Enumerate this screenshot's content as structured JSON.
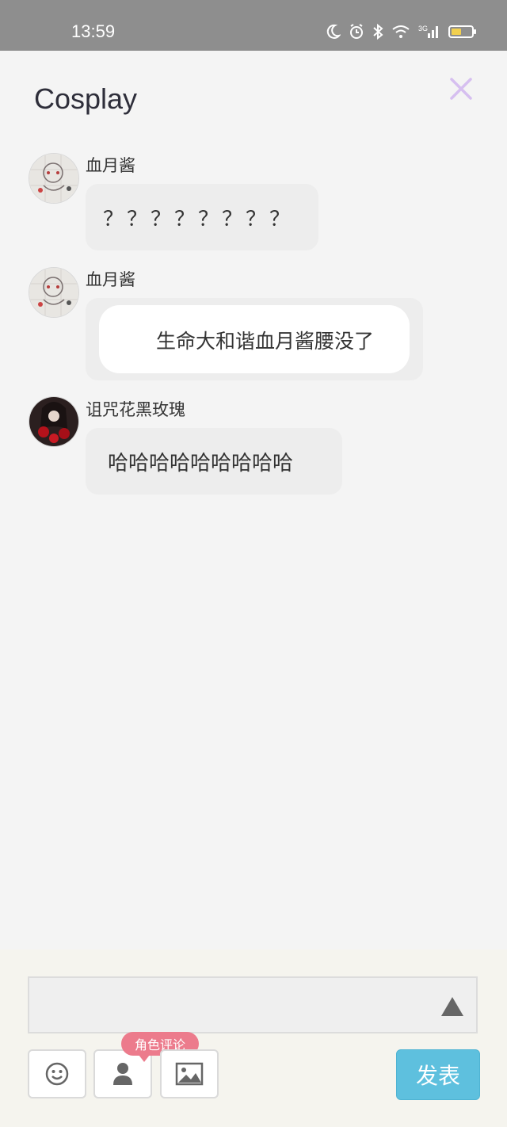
{
  "status_bar": {
    "time": "13:59",
    "icons": [
      "moon-icon",
      "alarm-icon",
      "bluetooth-icon",
      "wifi-icon",
      "signal-3g-icon",
      "battery-icon"
    ]
  },
  "header": {
    "title": "Cosplay",
    "close_icon": "close-icon"
  },
  "messages": [
    {
      "user": "血月酱",
      "text": "？？？？？？？？"
    },
    {
      "user": "血月酱",
      "text": "生命大和谐血月酱腰没了"
    },
    {
      "user": "诅咒花黑玫瑰",
      "text": "哈哈哈哈哈哈哈哈哈"
    }
  ],
  "composer": {
    "input_value": "",
    "expand_icon": "triangle-up-icon",
    "tools": [
      {
        "name": "emoji-icon"
      },
      {
        "name": "person-icon"
      },
      {
        "name": "image-icon"
      }
    ],
    "role_badge": "角色评论",
    "send_label": "发表"
  },
  "colors": {
    "status_bar": "#8e8e8e",
    "background": "#f4f4f4",
    "bubble": "#ededed",
    "send_button": "#5ec0de",
    "role_badge": "#ec7b8c",
    "close_icon": "#d6bff0"
  }
}
